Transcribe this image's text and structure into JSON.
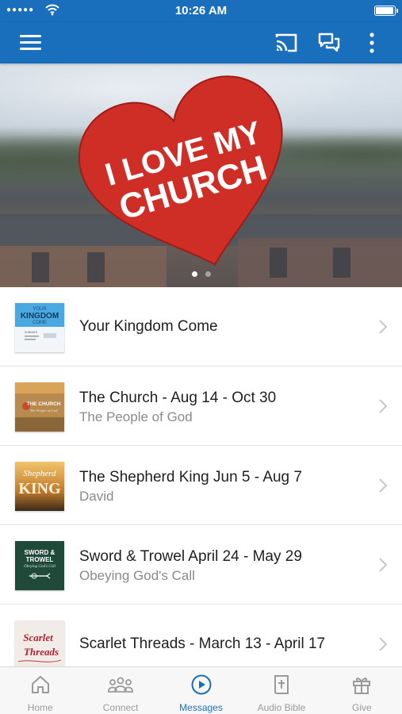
{
  "status_bar": {
    "signal": "●●●●●",
    "time": "10:26 AM",
    "icons": [
      "wifi-icon",
      "battery-icon"
    ]
  },
  "app_bar": {
    "color": "#1a6fbd",
    "icons": [
      "menu-icon",
      "cast-icon",
      "chat-icon",
      "more-vertical-icon"
    ]
  },
  "hero": {
    "heart_text_line1": "I LOVE MY",
    "heart_text_line2": "CHURCH",
    "heart_color": "#cf2e26",
    "page_count": 2,
    "active_page": 1
  },
  "series": [
    {
      "title": "Your Kingdom Come",
      "subtitle": "",
      "thumb": {
        "line1": "YOUR",
        "line2": "KINGDOM",
        "line3": "COME",
        "small": "SUNDAYS",
        "bg": "#4aa9e0"
      }
    },
    {
      "title": "The Church - Aug 14 - Oct 30",
      "subtitle": "The People of God",
      "thumb": {
        "line1": "THE CHURCH",
        "line2": "The People of God",
        "bg": "#b98a4f"
      }
    },
    {
      "title": "The Shepherd King Jun 5 - Aug 7",
      "subtitle": "David",
      "thumb": {
        "line1": "Shepherd",
        "line2": "KING",
        "bg": "#e0a43a"
      }
    },
    {
      "title": "Sword & Trowel April 24 - May 29",
      "subtitle": "Obeying God's Call",
      "thumb": {
        "line1": "SWORD &",
        "line2": "TROWEL",
        "line3": "Obeying God's Call",
        "bg": "#1f4a3a"
      }
    },
    {
      "title": "Scarlet Threads - March 13 - April 17",
      "subtitle": "",
      "thumb": {
        "line1": "Scarlet",
        "line2": "Threads",
        "bg": "#f1ece8"
      }
    }
  ],
  "tabs": [
    {
      "label": "Home",
      "icon": "home-icon",
      "active": false
    },
    {
      "label": "Connect",
      "icon": "people-icon",
      "active": false
    },
    {
      "label": "Messages",
      "icon": "play-circle-icon",
      "active": true
    },
    {
      "label": "Audio Bible",
      "icon": "bible-icon",
      "active": false
    },
    {
      "label": "Give",
      "icon": "gift-icon",
      "active": false
    }
  ],
  "colors": {
    "accent": "#1a6fbd",
    "tab_inactive": "#9a9a9a",
    "subtitle": "#8a8a8a"
  }
}
